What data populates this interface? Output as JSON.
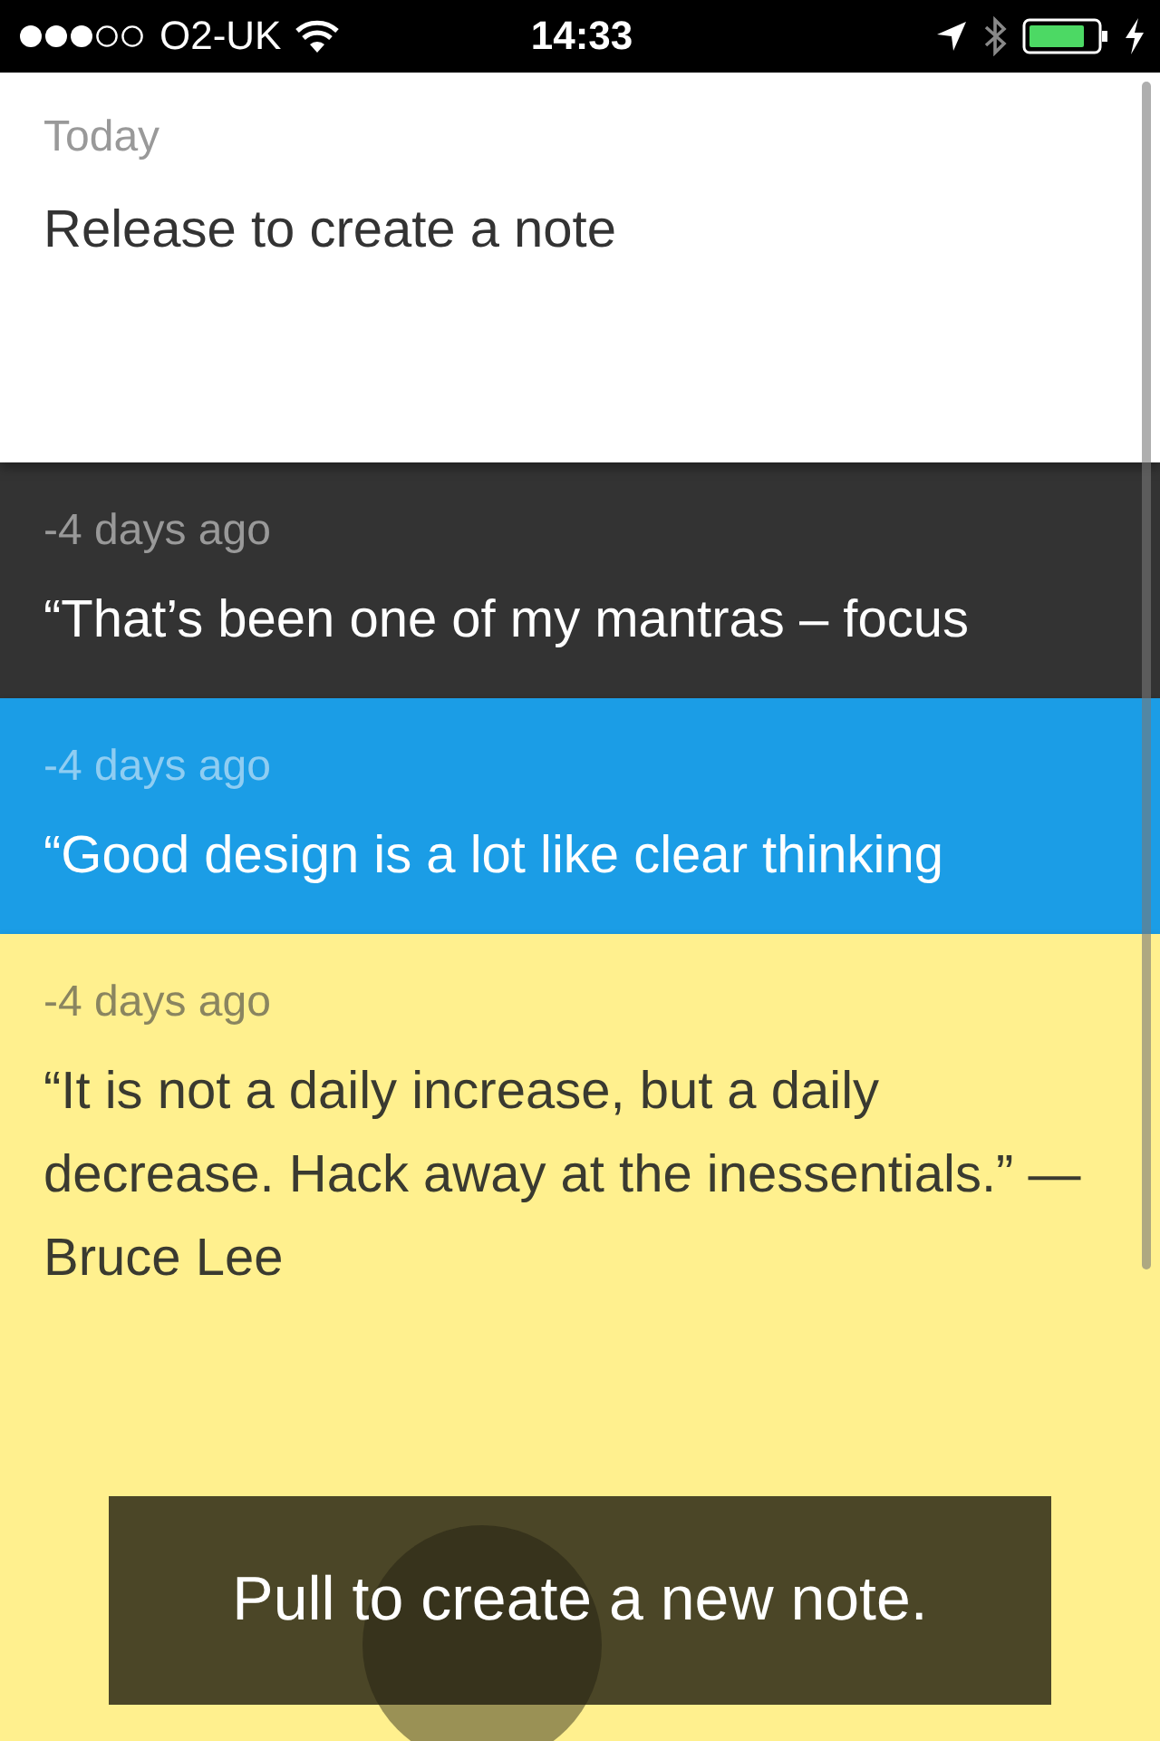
{
  "status_bar": {
    "carrier": "O2-UK",
    "time": "14:33"
  },
  "pull_header": {
    "date": "Today",
    "text": "Release to create a note"
  },
  "notes": [
    {
      "date": "-4 days ago",
      "text": "“That’s been one of my mantras – focus",
      "color": "#333333"
    },
    {
      "date": "-4 days ago",
      "text": "“Good design is a lot like clear thinking",
      "color": "#1b9de6"
    },
    {
      "date": "-4 days ago",
      "text": "“It is not a daily increase, but a daily decrease. Hack away at the inessentials.” — Bruce Lee",
      "color": "#fff08e"
    }
  ],
  "toast": {
    "text": "Pull to create a new note."
  }
}
